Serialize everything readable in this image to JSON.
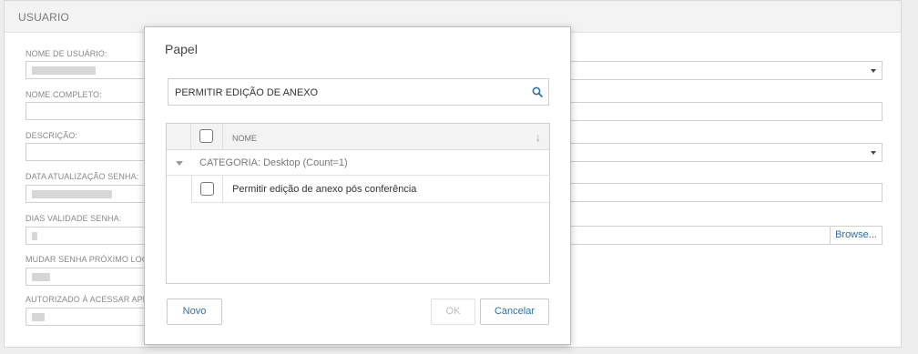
{
  "section": {
    "title": "USUARIO"
  },
  "form": {
    "fields": [
      {
        "label": "NOME DE USUÁRIO:"
      },
      {
        "label": "NOME COMPLETO:"
      },
      {
        "label": "DESCRIÇÃO:"
      },
      {
        "label": "DATA ATUALIZAÇÃO SENHA:"
      },
      {
        "label": "DIAS VALIDADE SENHA:"
      },
      {
        "label": "MUDAR SENHA PRÓXIMO LOGI"
      },
      {
        "label": "AUTORIZADO À ACESSAR API EX"
      }
    ],
    "right_partial_label": ":",
    "browse_label": "Browse..."
  },
  "dialog": {
    "title": "Papel",
    "search": {
      "value": "PERMITIR EDIÇÃO DE ANEXO",
      "icon": "search-icon"
    },
    "grid": {
      "column_header": "NOME",
      "sort_icon": "↓",
      "group_label": "CATEGORIA: Desktop (Count=1)",
      "rows": [
        {
          "name": "Permitir edição de anexo pós conferência",
          "checked": false
        }
      ]
    },
    "buttons": {
      "new": "Novo",
      "ok": "OK",
      "cancel": "Cancelar"
    }
  },
  "colors": {
    "accent": "#2f6ea8",
    "background": "#ededed"
  }
}
